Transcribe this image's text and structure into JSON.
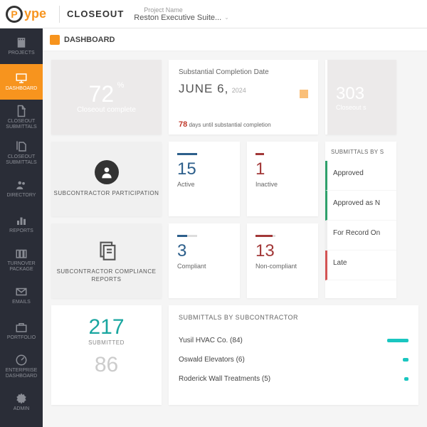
{
  "header": {
    "logo_p": "P",
    "logo_ype": "ype",
    "app": "CLOSEOUT",
    "project_label": "Project Name",
    "project_name": "Reston Executive Suite..."
  },
  "sidebar": {
    "items": [
      {
        "label": "PROJECTS"
      },
      {
        "label": "DASHBOARD"
      },
      {
        "label": "CLOSEOUT SUBMITTALS"
      },
      {
        "label": "CLOSEOUT SUBMITTALS"
      },
      {
        "label": "DIRECTORY"
      },
      {
        "label": "REPORTS"
      },
      {
        "label": "TURNOVER PACKAGE"
      },
      {
        "label": "EMAILS"
      },
      {
        "label": "PORTFOLIO"
      },
      {
        "label": "ENTERPRISE DASHBOARD"
      },
      {
        "label": "ADMIN"
      }
    ]
  },
  "page_title": "DASHBOARD",
  "completion": {
    "value": "72",
    "pct": "%",
    "label": "Closeout complete"
  },
  "date_card": {
    "title": "Substantial Completion Date",
    "month_day": "JUNE 6,",
    "year": "2024",
    "days": "78",
    "days_label": "days until substantial completion"
  },
  "stat303": {
    "value": "303",
    "label": "Closeout s"
  },
  "participation": {
    "title": "SUBCONTRACTOR PARTICIPATION"
  },
  "active": {
    "value": "15",
    "label": "Active"
  },
  "inactive": {
    "value": "1",
    "label": "Inactive"
  },
  "compliance": {
    "title": "SUBCONTRACTOR COMPLIANCE REPORTS"
  },
  "compliant": {
    "value": "3",
    "label": "Compliant"
  },
  "noncompliant": {
    "value": "13",
    "label": "Non-compliant"
  },
  "status": {
    "title": "SUBMITTALS BY S",
    "rows": [
      "Approved",
      "Approved as N",
      "For Record On",
      "Late"
    ]
  },
  "submitted": {
    "value": "217",
    "label": "SUBMITTED",
    "secondary": "86"
  },
  "sub_list": {
    "title": "SUBMITTALS BY SUBCONTRACTOR",
    "rows": [
      "Yusil HVAC Co. (84)",
      "Oswald Elevators (6)",
      "Roderick Wall Treatments (5)"
    ]
  }
}
